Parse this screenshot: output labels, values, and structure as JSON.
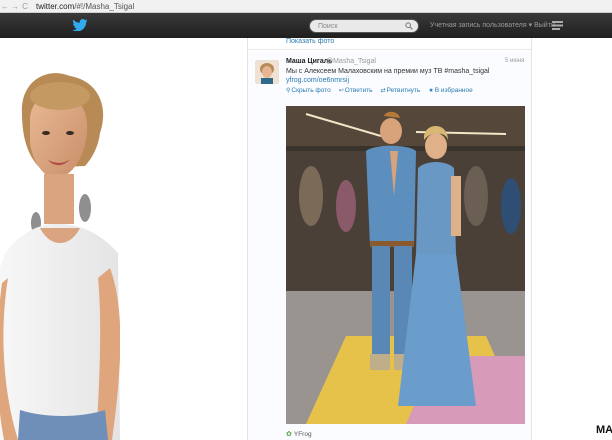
{
  "browser": {
    "url_host": "twitter.com",
    "url_path": "/#!/Masha_Tsigal",
    "back_label": "←",
    "forward_label": "→",
    "reload_label": "C"
  },
  "header": {
    "search_placeholder": "Поиск",
    "account_label": "Учетная запись пользователя ▾ Выйти"
  },
  "previous_tweet": {
    "link_label": "Показать фото"
  },
  "tweet": {
    "name": "Маша Цигаль",
    "handle": "@Masha_Tsigal",
    "time": "5 июня",
    "text": "Мы с Алексеем Малаховским на премии муз TB #masha_tsigal",
    "link": "yfrog.com/oe6nmrsij",
    "actions": {
      "hide_photo": "Скрыть фото",
      "reply": "Ответить",
      "retweet": "Ретвитнуть",
      "favorite": "В избранное"
    },
    "source": "YFrog"
  },
  "page": {
    "right_text": "MA"
  },
  "colors": {
    "topbar": "#2c2c2c",
    "link": "#2a7ab0",
    "twitter_blue": "#33aaee"
  }
}
